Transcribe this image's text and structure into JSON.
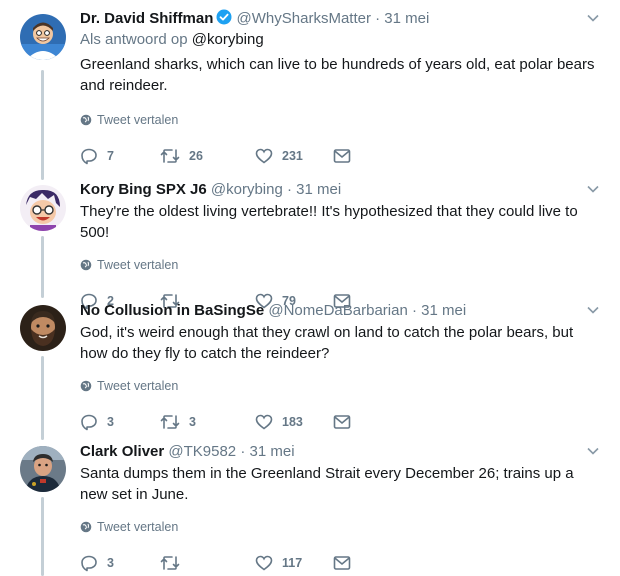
{
  "translate_label": "Tweet vertalen",
  "colors": {
    "muted": "#657786",
    "verified": "#1da1f2",
    "thread_line": "#c4cfd6"
  },
  "tweets": [
    {
      "name": "Dr. David Shiffman",
      "verified": true,
      "handle": "@WhySharksMatter",
      "separator": "·",
      "date": "31 mei",
      "reply_prefix": "Als antwoord op",
      "reply_mention": "@korybing",
      "text": "Greenland sharks, which can live to be hundreds of years old, eat polar bears and reindeer.",
      "replies": "7",
      "retweets": "26",
      "likes": "231",
      "avatar_icon": "cartoon-shark-avatar"
    },
    {
      "name": "Kory Bing SPX J6",
      "verified": false,
      "handle": "@korybing",
      "separator": "·",
      "date": "31 mei",
      "text": "They're the oldest living vertebrate!! It's hypothesized that they could live to 500!",
      "replies": "2",
      "retweets": "",
      "likes": "79",
      "avatar_icon": "cartoon-character-avatar"
    },
    {
      "name": "No Collusion in BaSingSe",
      "verified": false,
      "handle": "@NomeDaBarbarian",
      "separator": "·",
      "date": "31 mei",
      "text": "God, it's weird enough that they crawl on land to catch the polar bears, but how do they fly to catch the reindeer?",
      "replies": "3",
      "retweets": "3",
      "likes": "183",
      "avatar_icon": "bearded-man-photo-avatar"
    },
    {
      "name": "Clark Oliver",
      "verified": false,
      "handle": "@TK9582",
      "separator": "·",
      "date": "31 mei",
      "text": "Santa dumps them in the Greenland Strait every December 26; trains up a new set in June.",
      "replies": "3",
      "retweets": "",
      "likes": "117",
      "avatar_icon": "firefighter-photo-avatar"
    }
  ]
}
